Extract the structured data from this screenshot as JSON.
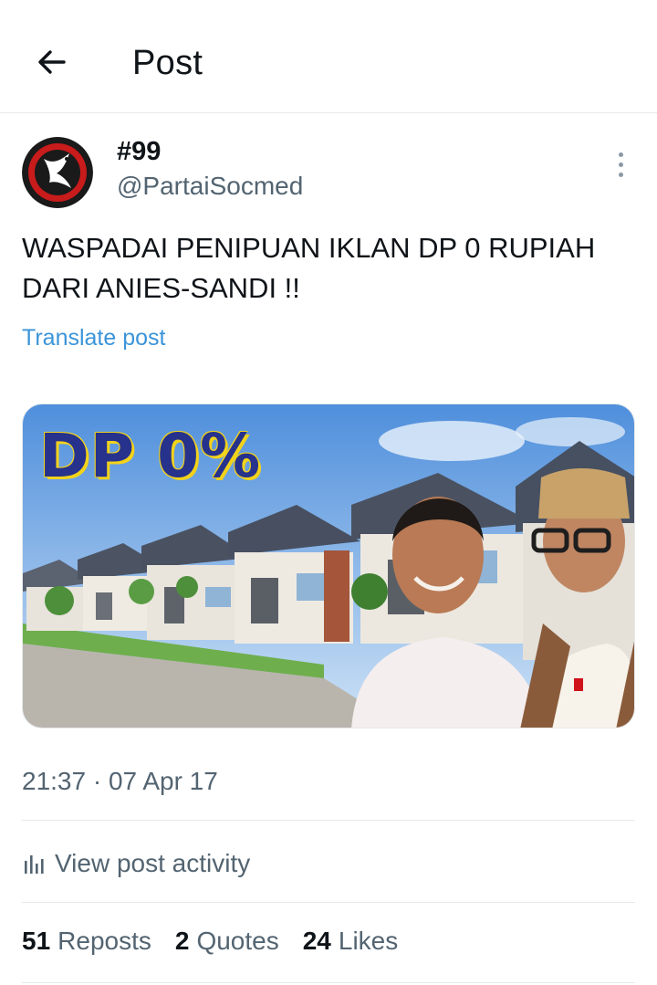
{
  "header": {
    "title": "Post",
    "back_icon": "arrow-left-icon"
  },
  "author": {
    "display_name": "#99",
    "handle": "@PartaiSocmed",
    "avatar_icon": "party-logo-icon",
    "avatar_text": "@PARTAISOCMED"
  },
  "post": {
    "text": "WASPADAI PENIPUAN IKLAN DP 0 RUPIAH DARI ANIES-SANDI !!",
    "translate_label": "Translate post",
    "media": {
      "caption": "DP 0%"
    },
    "timestamp": "21:37 · 07 Apr 17"
  },
  "activity": {
    "label": "View post activity",
    "icon": "bar-chart-icon"
  },
  "stats": [
    {
      "value": "51",
      "label": "Reposts"
    },
    {
      "value": "2",
      "label": "Quotes"
    },
    {
      "value": "24",
      "label": "Likes"
    }
  ],
  "colors": {
    "link": "#3b94d9",
    "muted": "#536471",
    "text": "#0f1419",
    "divider": "#e6e9eb"
  }
}
